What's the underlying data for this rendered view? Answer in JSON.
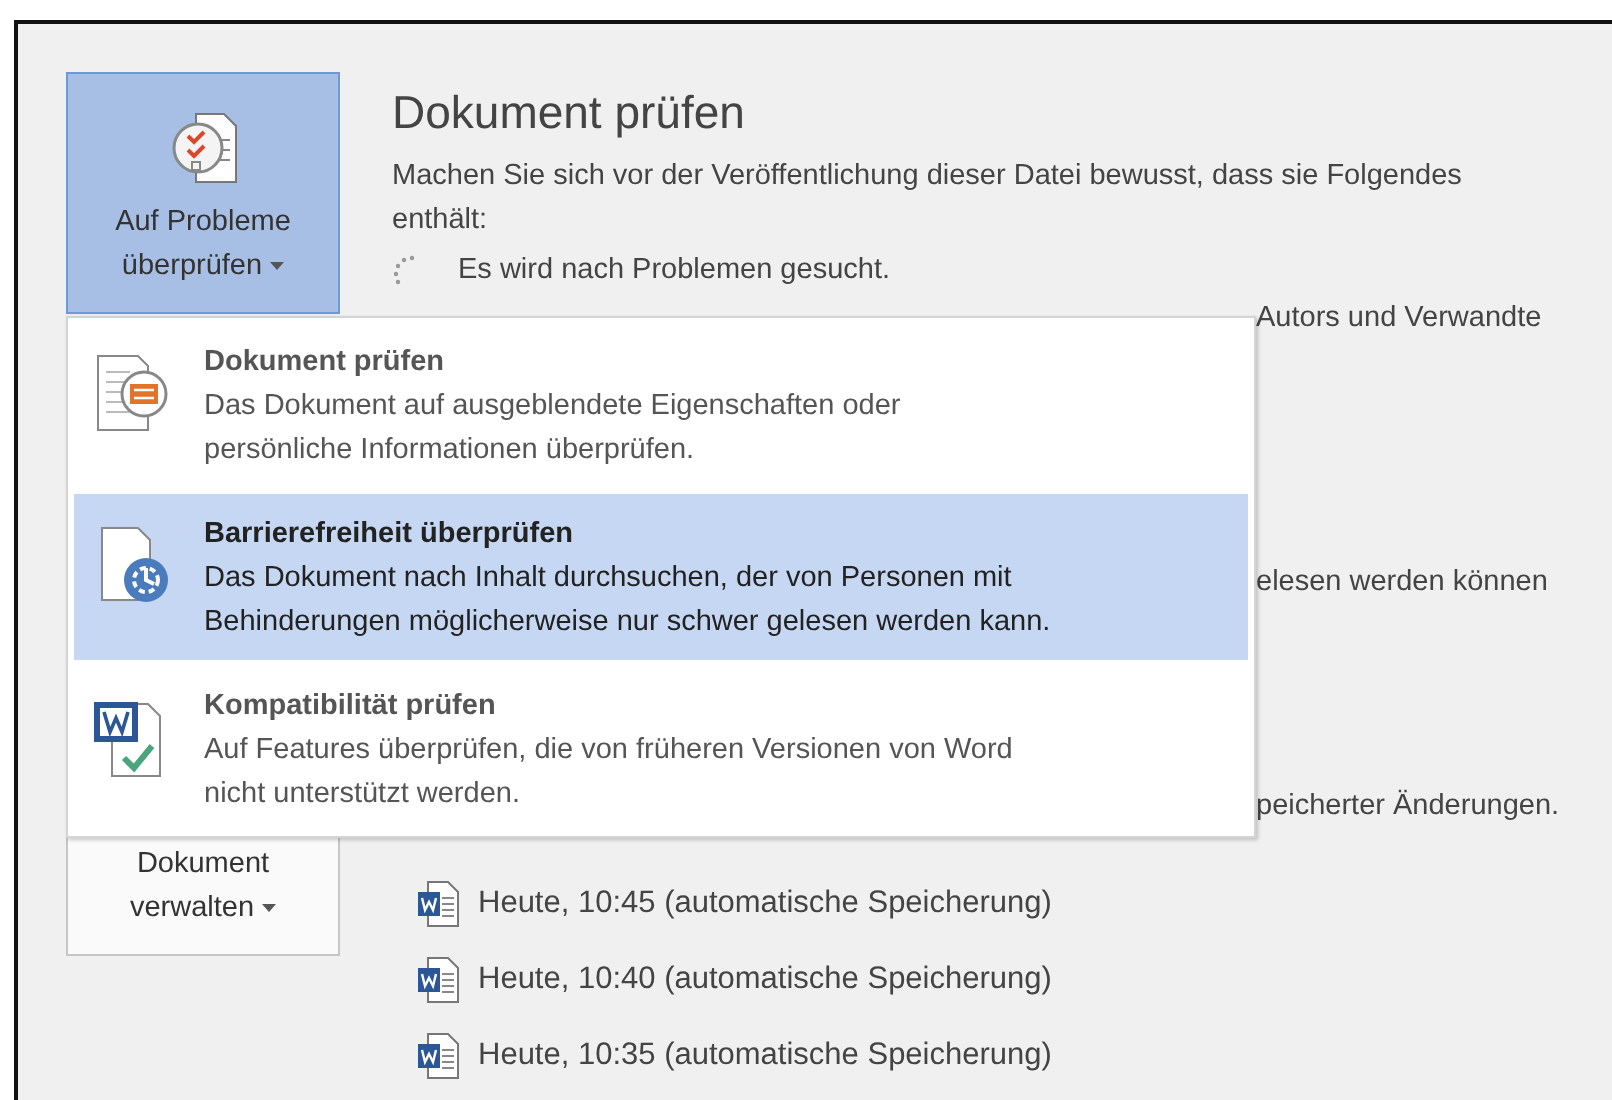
{
  "buttons": [
    {
      "label": "Auf Probleme überprüfen",
      "kind": "inspect",
      "selected": true
    },
    {
      "label": "Dokument verwalten",
      "kind": "manage",
      "selected": false
    }
  ],
  "section": {
    "title": "Dokument prüfen",
    "description": "Machen Sie sich vor der Veröffentlichung dieser Datei bewusst, dass sie Folgendes",
    "description_2": "enthält:",
    "status": "Es wird nach Problemen gesucht."
  },
  "hidden_fragments": [
    "Autors und Verwandte",
    "elesen werden können",
    "peicherter Änderungen."
  ],
  "versions": [
    {
      "label": "Heute, 10:45 (automatische Speicherung)"
    },
    {
      "label": "Heute, 10:40 (automatische Speicherung)"
    },
    {
      "label": "Heute, 10:35 (automatische Speicherung)"
    }
  ],
  "menu": [
    {
      "kind": "inspect",
      "title": "Dokument prüfen",
      "description": [
        "Das Dokument auf ausgeblendete Eigenschaften oder",
        "persönliche Informationen überprüfen."
      ],
      "selected": false
    },
    {
      "kind": "accessibility",
      "title": "Barrierefreiheit überprüfen",
      "description": [
        "Das Dokument nach Inhalt durchsuchen, der von Personen mit",
        "Behinderungen möglicherweise nur schwer gelesen werden kann."
      ],
      "selected": true
    },
    {
      "kind": "compatibility",
      "title": "Kompatibilität prüfen",
      "description": [
        "Auf Features überprüfen, die von früheren Versionen von Word",
        "nicht unterstützt werden."
      ],
      "selected": false
    }
  ]
}
